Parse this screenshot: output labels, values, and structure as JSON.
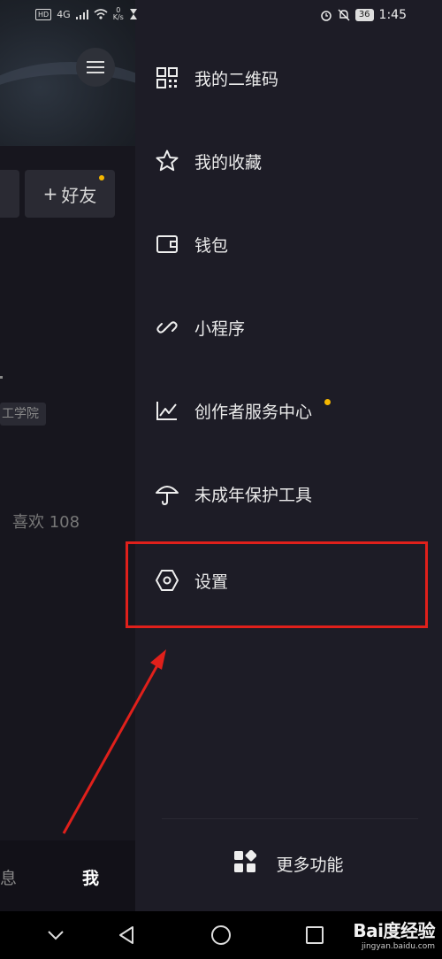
{
  "status_bar": {
    "left_hd": "HD",
    "left_net": "4G",
    "left_speed_value": "0",
    "left_speed_unit": "K/s",
    "battery": "36",
    "time": "1:45"
  },
  "profile": {
    "add_friend_label": "好友",
    "school_tag": "工学院",
    "likes_text": "喜欢 108",
    "nav_messages": "息",
    "nav_me": "我"
  },
  "drawer": {
    "items": [
      {
        "label": "我的二维码",
        "icon": "qr-code-icon"
      },
      {
        "label": "我的收藏",
        "icon": "star-icon"
      },
      {
        "label": "钱包",
        "icon": "wallet-icon"
      },
      {
        "label": "小程序",
        "icon": "link-icon"
      },
      {
        "label": "创作者服务中心",
        "icon": "chart-icon",
        "badge": true
      },
      {
        "label": "未成年保护工具",
        "icon": "umbrella-icon"
      },
      {
        "label": "设置",
        "icon": "settings-hexagon-icon"
      }
    ],
    "more_label": "更多功能"
  },
  "watermark": {
    "main": "Bai度经验",
    "sub": "jingyan.baidu.com"
  },
  "colors": {
    "accent_badge": "#f5b700",
    "annotation_red": "#e0201b"
  }
}
